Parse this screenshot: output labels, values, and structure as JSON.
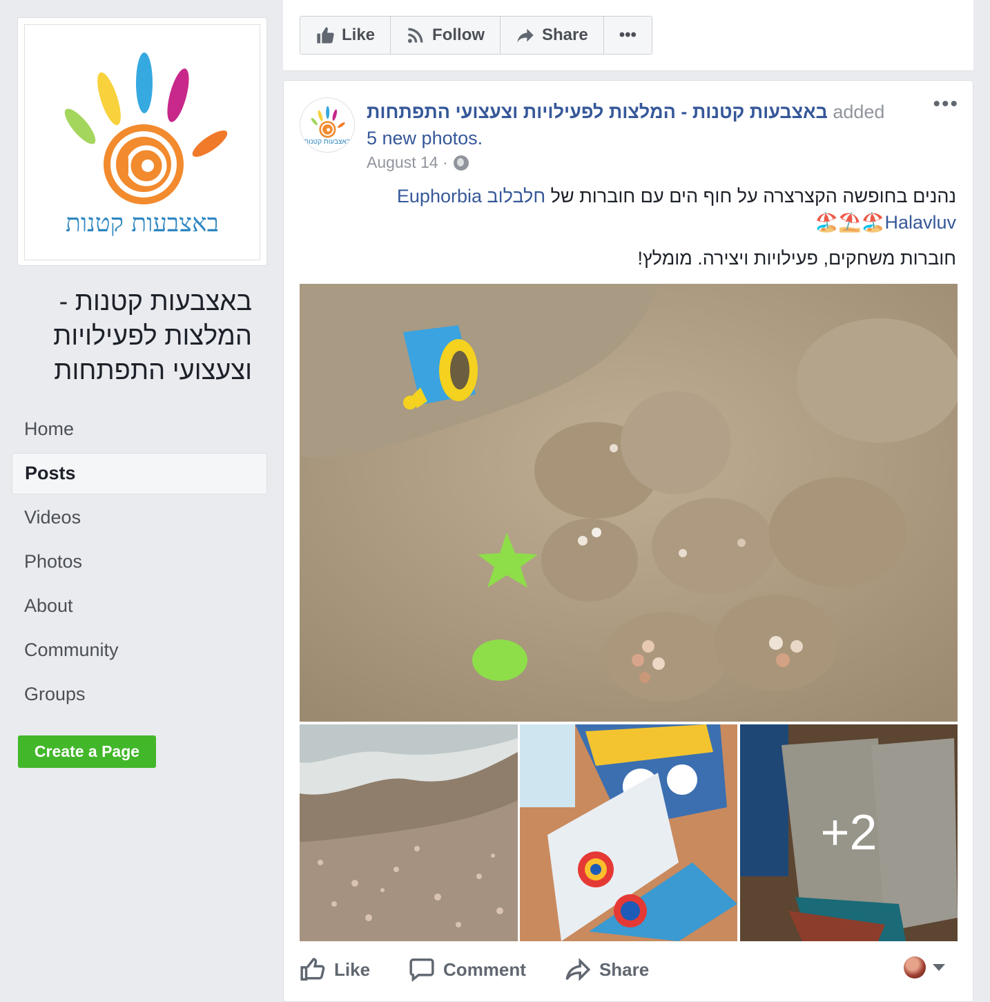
{
  "sidebar": {
    "logo_text": "באצבעות קטנות",
    "page_name": "באצבעות קטנות - המלצות לפעילויות וצעצועי התפתחות",
    "nav": [
      {
        "label": "Home"
      },
      {
        "label": "Posts"
      },
      {
        "label": "Videos"
      },
      {
        "label": "Photos"
      },
      {
        "label": "About"
      },
      {
        "label": "Community"
      },
      {
        "label": "Groups"
      }
    ],
    "create_page_label": "Create a Page"
  },
  "page_actions": {
    "like": "Like",
    "follow": "Follow",
    "share": "Share",
    "more": "•••"
  },
  "post": {
    "author": "באצבעות קטנות - המלצות לפעילויות וצעצועי התפתחות",
    "action": "added",
    "photos_link": "5 new photos.",
    "date": "August 14 ·",
    "more": "•••",
    "text_line1_part1": "נהנים בחופשה הקצרצרה על חוף הים עם חוברות של ",
    "text_line1_link": "חלבלוב Euphorbia",
    "text_line2_link": "Halavluv",
    "text_line2_emoji": "🏖️⛱️🏖️",
    "text_line3": "חוברות משחקים, פעילויות ויצירה. מומלץ!",
    "more_photos_count": "+2",
    "actions": {
      "like": "Like",
      "comment": "Comment",
      "share": "Share"
    }
  },
  "colors": {
    "link": "#365899",
    "green_button": "#42b72a",
    "background": "#e9ebee"
  }
}
